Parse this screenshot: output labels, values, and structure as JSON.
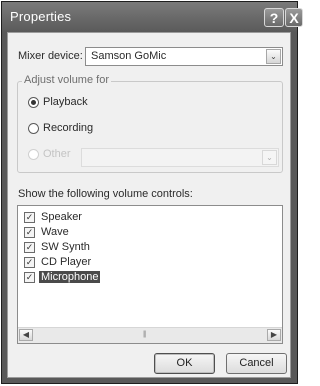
{
  "window": {
    "title": "Properties",
    "help_glyph": "?",
    "close_glyph": "X"
  },
  "mixer": {
    "label": "Mixer device:",
    "value": "Samson GoMic"
  },
  "adjust_volume": {
    "legend": "Adjust volume for",
    "options": [
      {
        "label": "Playback",
        "checked": true,
        "enabled": true
      },
      {
        "label": "Recording",
        "checked": false,
        "enabled": true
      },
      {
        "label": "Other",
        "checked": false,
        "enabled": false
      }
    ],
    "other_value": ""
  },
  "controls": {
    "label": "Show the following volume controls:",
    "items": [
      {
        "label": "Speaker",
        "checked": true,
        "selected": false
      },
      {
        "label": "Wave",
        "checked": true,
        "selected": false
      },
      {
        "label": "SW Synth",
        "checked": true,
        "selected": false
      },
      {
        "label": "CD Player",
        "checked": true,
        "selected": false
      },
      {
        "label": "Microphone",
        "checked": true,
        "selected": true
      }
    ]
  },
  "buttons": {
    "ok": "OK",
    "cancel": "Cancel"
  },
  "icons": {
    "checkmark": "✓",
    "dropdown_arrow": "⌄",
    "scroll_left": "◀",
    "scroll_right": "▶"
  }
}
